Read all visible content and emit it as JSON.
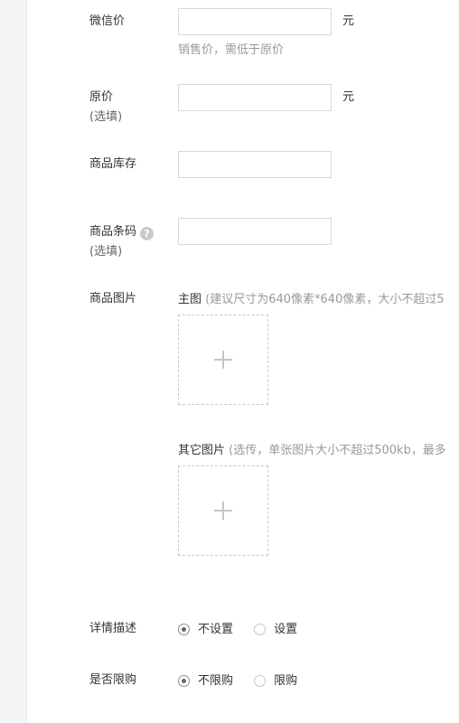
{
  "form": {
    "wechat_price": {
      "label": "微信价",
      "value": "",
      "unit": "元",
      "hint": "销售价，需低于原价"
    },
    "original_price": {
      "label": "原价",
      "sublabel": "(选填)",
      "value": "",
      "unit": "元"
    },
    "stock": {
      "label": "商品库存",
      "value": ""
    },
    "barcode": {
      "label": "商品条码",
      "sublabel": "(选填)",
      "help_icon": "?",
      "value": ""
    },
    "images": {
      "label": "商品图片",
      "main_title": "主图",
      "main_note": "(建议尺寸为640像素*640像素，大小不超过5",
      "other_title": "其它图片",
      "other_note": "(选传，单张图片大小不超过500kb，最多"
    },
    "description": {
      "label": "详情描述",
      "options": [
        "不设置",
        "设置"
      ],
      "selected": "不设置"
    },
    "purchase_limit": {
      "label": "是否限购",
      "options": [
        "不限购",
        "限购"
      ],
      "selected": "不限购"
    }
  }
}
